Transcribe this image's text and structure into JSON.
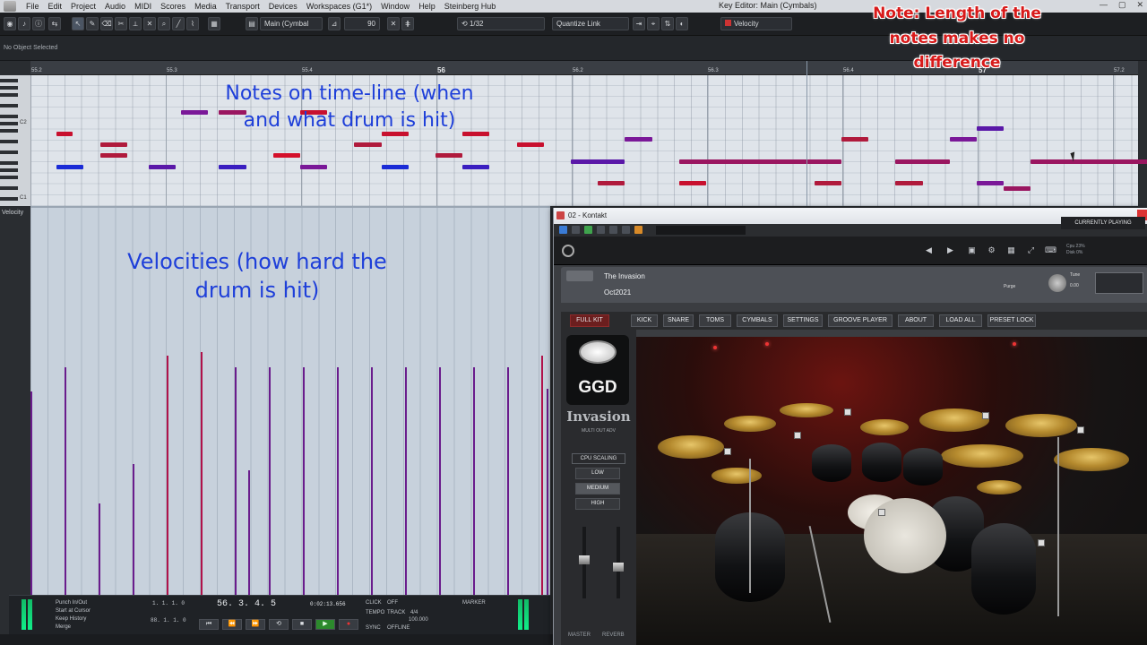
{
  "menubar": {
    "items": [
      "File",
      "Edit",
      "Project",
      "Audio",
      "MIDI",
      "Scores",
      "Media",
      "Transport",
      "Devices",
      "Workspaces (G1*)",
      "Window",
      "Help",
      "Steinberg Hub"
    ],
    "window_title": "Key Editor: Main (Cymbals)"
  },
  "toolbar": {
    "track_name": "Main (Cymbal",
    "value_90": "90",
    "quantize": "1/32",
    "quantize_link": "Quantize Link",
    "velocity": "Velocity"
  },
  "info_line": "No Object Selected",
  "ruler": {
    "ticks": [
      "55.2",
      "55.3",
      "55.4",
      "56",
      "56.2",
      "56.3",
      "56.4",
      "57",
      "57.2"
    ]
  },
  "keyboard": {
    "labels": [
      "C2",
      "C1"
    ]
  },
  "velocity_lane": {
    "label": "Velocity"
  },
  "annotations": {
    "notes_line1": "Notes on time-line (when",
    "notes_line2": "and what drum is hit)",
    "velocity_line1": "Velocities (how hard the",
    "velocity_line2": "drum is hit)",
    "red_line1": "Note: Length of the",
    "red_line2": "notes makes no",
    "red_line3": "difference"
  },
  "transport": {
    "punch_in_out": "Punch In/Out",
    "start_at_cursor": "Start at Cursor",
    "keep_history": "Keep History",
    "merge": "Merge",
    "left_locator": "1. 1. 1. 0",
    "right_locator": "88. 1. 1. 0",
    "position": "56. 3. 4. 5",
    "time": "0:02:13.656",
    "click_label": "CLICK",
    "click_value": "OFF",
    "tempo_label": "TEMPO",
    "tempo_value": "TRACK",
    "sync_label": "SYNC",
    "sync_value": "OFFLINE",
    "signature": "4/4",
    "tempo_bpm": "100.000",
    "marker_label": "MARKER"
  },
  "kontakt": {
    "title": "02 - Kontakt",
    "instrument_name": "The Invasion",
    "preset_name": "Oct2021",
    "purge": "Purge",
    "tune": "Tune",
    "tune_value": "0.00",
    "cpu_line1": "Cpu 23%",
    "cpu_line2": "Disk 0%",
    "tabs": [
      "FULL KIT",
      "KICK",
      "SNARE",
      "TOMS",
      "CYMBALS",
      "SETTINGS",
      "GROOVE PLAYER",
      "ABOUT",
      "LOAD ALL",
      "PRESET LOCK"
    ],
    "active_tab": "FULL KIT",
    "currently_playing": "CURRENTLY PLAYING",
    "logo_text": "GGD",
    "brand": "Invasion",
    "multi_out": "MULTI OUT ADV",
    "cpu_scaling": "CPU SCALING",
    "cpu_options": [
      "LOW",
      "MEDIUM",
      "HIGH"
    ],
    "cpu_active": "MEDIUM",
    "master": "MASTER",
    "reverb": "REVERB"
  },
  "chart_data": {
    "type": "bar",
    "title": "",
    "notes": [
      {
        "start": 55.05,
        "length": 0.02,
        "row": 5,
        "color": "#c8102e"
      },
      {
        "start": 55.05,
        "length": 0.05,
        "row": 8,
        "color": "#1a2bd6"
      },
      {
        "start": 55.13,
        "length": 0.05,
        "row": 6,
        "color": "#b01a3c"
      },
      {
        "start": 55.13,
        "length": 0.05,
        "row": 7,
        "color": "#b01a3c"
      },
      {
        "start": 55.22,
        "length": 0.05,
        "row": 8,
        "color": "#5a18a8"
      },
      {
        "start": 55.28,
        "length": 0.05,
        "row": 3,
        "color": "#7a1898"
      },
      {
        "start": 55.35,
        "length": 0.05,
        "row": 3,
        "color": "#9a1660"
      },
      {
        "start": 55.35,
        "length": 0.05,
        "row": 8,
        "color": "#3a1ec0"
      },
      {
        "start": 55.45,
        "length": 0.05,
        "row": 7,
        "color": "#d40f2a"
      },
      {
        "start": 55.5,
        "length": 0.05,
        "row": 3,
        "color": "#c8102e"
      },
      {
        "start": 55.5,
        "length": 0.05,
        "row": 8,
        "color": "#7a1898"
      },
      {
        "start": 55.6,
        "length": 0.05,
        "row": 6,
        "color": "#b01a3c"
      },
      {
        "start": 55.65,
        "length": 0.05,
        "row": 5,
        "color": "#c8102e"
      },
      {
        "start": 55.65,
        "length": 0.05,
        "row": 8,
        "color": "#1a2bd6"
      },
      {
        "start": 55.75,
        "length": 0.05,
        "row": 7,
        "color": "#b01a3c"
      },
      {
        "start": 55.8,
        "length": 0.05,
        "row": 5,
        "color": "#c8102e"
      },
      {
        "start": 55.8,
        "length": 0.05,
        "row": 8,
        "color": "#3a1ec0"
      },
      {
        "start": 55.9,
        "length": 0.05,
        "row": 6,
        "color": "#c8102e"
      },
      {
        "start": 56.0,
        "length": 0.1,
        "row": 7.5,
        "color": "#5a18a8"
      },
      {
        "start": 56.05,
        "length": 0.05,
        "row": 9.5,
        "color": "#b01a3c"
      },
      {
        "start": 56.1,
        "length": 0.05,
        "row": 5.5,
        "color": "#7a1898"
      },
      {
        "start": 56.2,
        "length": 0.3,
        "row": 7.5,
        "color": "#9a1660"
      },
      {
        "start": 56.2,
        "length": 0.05,
        "row": 9.5,
        "color": "#c8102e"
      },
      {
        "start": 56.45,
        "length": 0.05,
        "row": 9.5,
        "color": "#b01a3c"
      },
      {
        "start": 56.5,
        "length": 0.05,
        "row": 5.5,
        "color": "#b01a3c"
      },
      {
        "start": 56.6,
        "length": 0.1,
        "row": 7.5,
        "color": "#9a1660"
      },
      {
        "start": 56.6,
        "length": 0.05,
        "row": 9.5,
        "color": "#b01a3c"
      },
      {
        "start": 56.7,
        "length": 0.05,
        "row": 5.5,
        "color": "#7a1898"
      },
      {
        "start": 56.75,
        "length": 0.05,
        "row": 9.5,
        "color": "#7a1898"
      },
      {
        "start": 56.75,
        "length": 0.05,
        "row": 4.5,
        "color": "#5a18a8"
      },
      {
        "start": 56.8,
        "length": 0.05,
        "row": 10,
        "color": "#9a1660"
      },
      {
        "start": 56.85,
        "length": 0.3,
        "row": 7.5,
        "color": "#9a1660"
      }
    ],
    "velocities": [
      {
        "x": 55.0,
        "value": 67
      },
      {
        "x": 55.05,
        "value": 75
      },
      {
        "x": 55.1,
        "value": 30
      },
      {
        "x": 55.15,
        "value": 43
      },
      {
        "x": 55.2,
        "value": 79
      },
      {
        "x": 55.25,
        "value": 80
      },
      {
        "x": 55.3,
        "value": 75
      },
      {
        "x": 55.32,
        "value": 41
      },
      {
        "x": 55.35,
        "value": 75
      },
      {
        "x": 55.4,
        "value": 75
      },
      {
        "x": 55.45,
        "value": 75
      },
      {
        "x": 55.5,
        "value": 75
      },
      {
        "x": 55.55,
        "value": 75
      },
      {
        "x": 55.6,
        "value": 75
      },
      {
        "x": 55.65,
        "value": 75
      },
      {
        "x": 55.7,
        "value": 75
      },
      {
        "x": 55.75,
        "value": 79
      },
      {
        "x": 55.8,
        "value": 60
      },
      {
        "x": 55.85,
        "value": 68
      }
    ]
  }
}
